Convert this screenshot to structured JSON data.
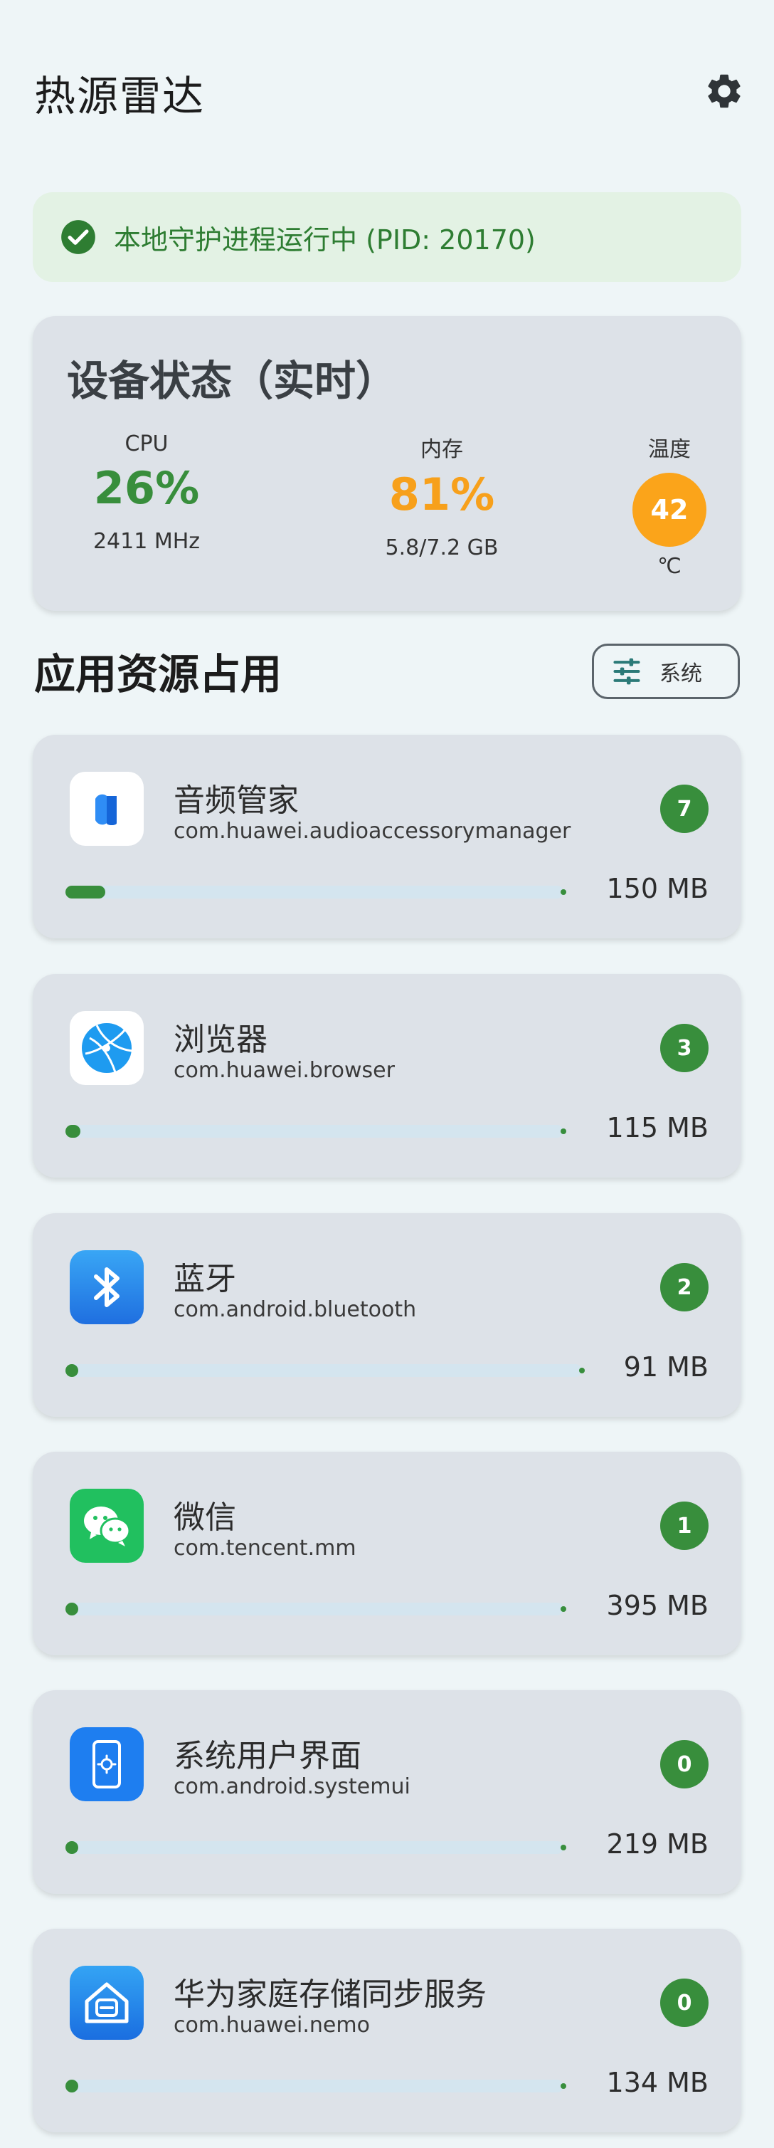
{
  "header": {
    "title": "热源雷达",
    "settings_icon": "gear-icon"
  },
  "status_banner": {
    "icon": "check-circle-icon",
    "text": "本地守护进程运行中 (PID: 20170)",
    "color": "#2e7d32"
  },
  "device_status": {
    "title": "设备状态（实时）",
    "cpu": {
      "label": "CPU",
      "value": "26%",
      "sub": "2411 MHz",
      "color": "#388e3c"
    },
    "memory": {
      "label": "内存",
      "value": "81%",
      "sub": "5.8/7.2 GB",
      "color": "#f7a01b"
    },
    "temperature": {
      "label": "温度",
      "value": "42",
      "unit": "℃",
      "color": "#fba41a"
    }
  },
  "app_usage": {
    "title": "应用资源占用",
    "filter_label": "系统",
    "filter_icon": "tune-icon",
    "apps": [
      {
        "name": "音频管家",
        "package": "com.huawei.audioaccessorymanager",
        "process_count": "7",
        "memory": "150 MB",
        "usage_fraction": 0.08,
        "icon": "audio-manager-icon"
      },
      {
        "name": "浏览器",
        "package": "com.huawei.browser",
        "process_count": "3",
        "memory": "115 MB",
        "usage_fraction": 0.03,
        "icon": "browser-icon"
      },
      {
        "name": "蓝牙",
        "package": "com.android.bluetooth",
        "process_count": "2",
        "memory": "91 MB",
        "usage_fraction": 0.02,
        "icon": "bluetooth-icon"
      },
      {
        "name": "微信",
        "package": "com.tencent.mm",
        "process_count": "1",
        "memory": "395 MB",
        "usage_fraction": 0.0,
        "icon": "wechat-icon"
      },
      {
        "name": "系统用户界面",
        "package": "com.android.systemui",
        "process_count": "0",
        "memory": "219 MB",
        "usage_fraction": 0.0,
        "icon": "system-ui-icon"
      },
      {
        "name": "华为家庭存储同步服务",
        "package": "com.huawei.nemo",
        "process_count": "0",
        "memory": "134 MB",
        "usage_fraction": 0.0,
        "icon": "home-storage-icon"
      }
    ]
  }
}
